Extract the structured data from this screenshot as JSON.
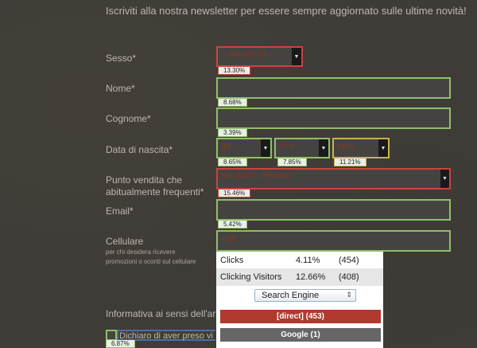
{
  "intro": "Iscriviti alla nostra newsletter per essere sempre aggiornato sulle ultime novità!",
  "form": {
    "sesso": {
      "label": "Sesso*",
      "value": "-- seleziona --",
      "pct": "13.30%"
    },
    "nome": {
      "label": "Nome*",
      "pct": "8.68%"
    },
    "cognome": {
      "label": "Cognome*",
      "pct": "3.39%"
    },
    "nascita": {
      "label": "Data di nascita*",
      "day": {
        "value": "gg",
        "pct": "8.65%"
      },
      "month": {
        "value": "mm",
        "pct": "7.85%"
      },
      "year": {
        "value": "yyyy",
        "pct": "11.21%"
      }
    },
    "punto": {
      "label_line1": "Punto vendita che",
      "label_line2": "abitualmente frequenti*",
      "value": "MILANO - Bonola",
      "pct": "15.46%"
    },
    "email": {
      "label": "Email*",
      "pct": "5.42%"
    },
    "cellulare": {
      "label": "Cellulare",
      "sub1": "per chi desidera ricevere",
      "sub2": "promozioni o sconti sul cellulare",
      "value": "+39"
    },
    "informativa": "Informativa ai sensi dell'art",
    "dichiaro": {
      "text": "Dichiaro di aver preso vi",
      "pct": "6.87%"
    }
  },
  "panel": {
    "clicks": {
      "label": "Clicks",
      "pct": "4.11%",
      "count": "(454)"
    },
    "visitors": {
      "label": "Clicking Visitors",
      "pct": "12.66%",
      "count": "(408)"
    },
    "engine": "Search Engine",
    "direct": "[direct] (453)",
    "google": "Google (1)"
  },
  "colors": {
    "green": "#8fbf6a",
    "red": "#c9443f",
    "yellow": "#c8b44a",
    "direct_bar": "#b03a2e",
    "google_bar": "#666666"
  }
}
